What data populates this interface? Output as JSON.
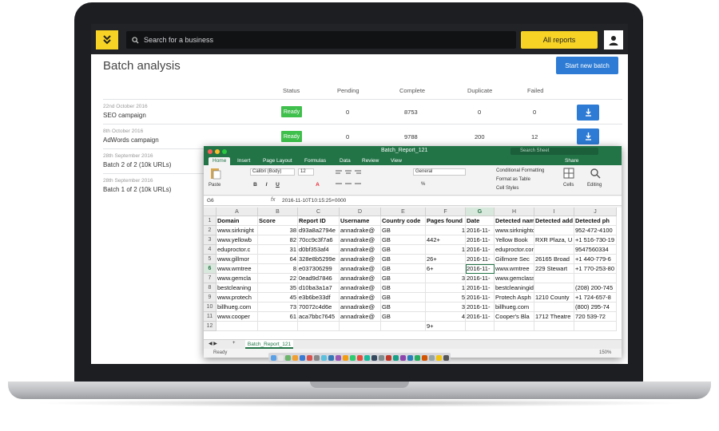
{
  "app": {
    "search_placeholder": "Search for a business",
    "all_reports_label": "All reports",
    "page_title": "Batch analysis",
    "start_batch_label": "Start new batch",
    "accent_yellow": "#f6d325",
    "accent_blue": "#2d7bd4",
    "ready_green": "#3fbf4c"
  },
  "table": {
    "headers": [
      "Status",
      "Pending",
      "Complete",
      "Duplicate",
      "Failed"
    ],
    "rows": [
      {
        "date": "22nd October 2016",
        "name": "SEO campaign",
        "status": "Ready",
        "pending": "0",
        "complete": "8753",
        "duplicate": "0",
        "failed": "0"
      },
      {
        "date": "8th October 2016",
        "name": "AdWords campaign",
        "status": "Ready",
        "pending": "0",
        "complete": "9788",
        "duplicate": "200",
        "failed": "12"
      },
      {
        "date": "28th September 2016",
        "name": "Batch 2 of 2 (10k URLs)"
      },
      {
        "date": "28th September 2016",
        "name": "Batch 1 of 2 (10k URLs)"
      }
    ]
  },
  "excel": {
    "title": "Batch_Report_121",
    "search_sheet": "Search Sheet",
    "tabs": [
      "Home",
      "Insert",
      "Page Layout",
      "Formulas",
      "Data",
      "Review",
      "View"
    ],
    "share_label": "Share",
    "ribbon": {
      "paste": "Paste",
      "font": "Calibri (Body)",
      "font_size": "12",
      "number_format": "General",
      "conditional": "Conditional Formatting",
      "format_table": "Format as Table",
      "cell_styles": "Cell Styles",
      "cells": "Cells",
      "editing": "Editing"
    },
    "cell_ref": "G6",
    "formula_value": "2016-11-10T10:15:25+0000",
    "columns": [
      "A",
      "B",
      "C",
      "D",
      "E",
      "F",
      "G",
      "H",
      "I",
      "J"
    ],
    "rows": [
      [
        "Domain",
        "Score",
        "Report ID",
        "Username",
        "Country code",
        "Pages found",
        "Date",
        "Detected nam",
        "Detected add",
        "Detected ph"
      ],
      [
        "www.sirknight",
        "38",
        "d93a8a2794e",
        "annadrake@",
        "GB",
        "",
        "2016-11-",
        "www.sirknightdrycleaners",
        "",
        "952-472-4100"
      ],
      [
        "www.yellowb",
        "82",
        "70cc9c3f7a6",
        "annadrake@",
        "GB",
        "442+",
        "2016-11-",
        "Yellow Book",
        "RXR Plaza, U",
        "+1 516-730-19"
      ],
      [
        "eduproctor.c",
        "31",
        "d0bf353af4",
        "annadrake@",
        "GB",
        "",
        "2016-11-",
        "eduproctor.com",
        "",
        "9547560334"
      ],
      [
        "www.gillmor",
        "64",
        "328e8b5299e",
        "annadrake@",
        "GB",
        "26+",
        "2016-11-",
        "Gillmore Sec",
        "26165 Broad",
        "+1 440-779-6"
      ],
      [
        "www.wmtree",
        "8",
        "e037306299",
        "annadrake@",
        "GB",
        "6+",
        "2016-11-",
        "www.wmtree",
        "229 Stewart",
        "+1 770-253-80"
      ],
      [
        "www.gemcla",
        "22",
        "0ead9d7846",
        "annadrake@",
        "GB",
        "",
        "2016-11-",
        "www.gemclassicroofing.com",
        "",
        ""
      ],
      [
        "bestcleaning",
        "35",
        "d10ba3a1a7",
        "annadrake@",
        "GB",
        "",
        "2016-11-",
        "bestcleaningid.com",
        "",
        "(208) 200-745"
      ],
      [
        "www.protech",
        "45",
        "e3b6be33df",
        "annadrake@",
        "GB",
        "",
        "2016-11-",
        "Protech Asph",
        "1210 County",
        "+1 724-657-8"
      ],
      [
        "billhueg.com",
        "73",
        "70072c4d6e",
        "annadrake@",
        "GB",
        "",
        "2016-11-",
        "billhueg.com",
        "",
        "(800) 295-74"
      ],
      [
        "www.cooper",
        "61",
        "aca7bbc7645",
        "annadrake@",
        "GB",
        "",
        "2016-11-",
        "Cooper's Bla",
        "1712 Theatre",
        "720 539-72"
      ],
      [
        "",
        "",
        "",
        "",
        "",
        "9+",
        "",
        "",
        "",
        ""
      ]
    ],
    "right_align_cols": [
      1,
      5
    ],
    "right_values": {
      "5_1": "1",
      "5_3": "1",
      "5_6": "3",
      "5_7": "1",
      "5_8": "5",
      "5_9": "3",
      "5_10": "4"
    },
    "sheet_tab": "Batch_Report_121",
    "status": "Ready",
    "zoom": "150%"
  }
}
